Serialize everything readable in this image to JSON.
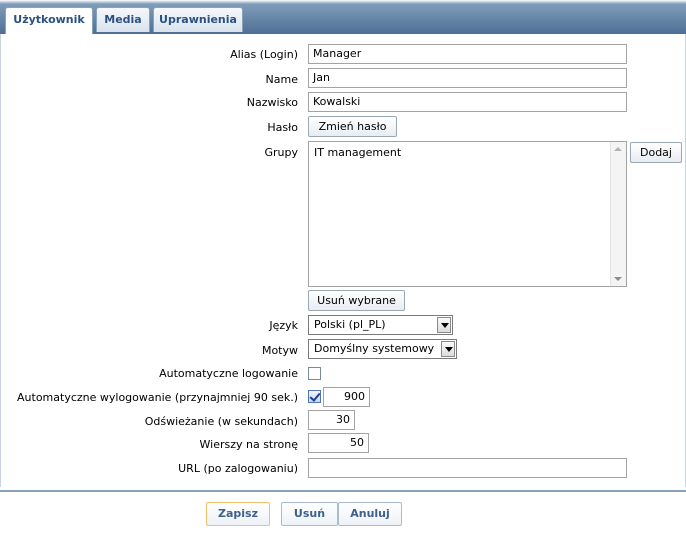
{
  "tabs": [
    {
      "label": "Użytkownik"
    },
    {
      "label": "Media"
    },
    {
      "label": "Uprawnienia"
    }
  ],
  "form": {
    "alias": {
      "label": "Alias (Login)",
      "value": "Manager"
    },
    "name": {
      "label": "Name",
      "value": "Jan"
    },
    "surname": {
      "label": "Nazwisko",
      "value": "Kowalski"
    },
    "password": {
      "label": "Hasło",
      "button": "Zmień hasło"
    },
    "groups": {
      "label": "Grupy",
      "items": [
        "IT management"
      ],
      "add_button": "Dodaj",
      "remove_button": "Usuń wybrane"
    },
    "language": {
      "label": "Język",
      "value": "Polski (pl_PL)"
    },
    "theme": {
      "label": "Motyw",
      "value": "Domyślny systemowy"
    },
    "autologin": {
      "label": "Automatyczne logowanie",
      "checked": false
    },
    "autologout": {
      "label": "Automatyczne wylogowanie (przynajmniej 90 sek.)",
      "checked": true,
      "value": "900"
    },
    "refresh": {
      "label": "Odświeżanie (w sekundach)",
      "value": "30"
    },
    "rows_per_page": {
      "label": "Wierszy na stronę",
      "value": "50"
    },
    "url": {
      "label": "URL (po zalogowaniu)",
      "value": ""
    }
  },
  "footer": {
    "save": "Zapisz",
    "delete": "Usuń",
    "cancel": "Anuluj"
  }
}
